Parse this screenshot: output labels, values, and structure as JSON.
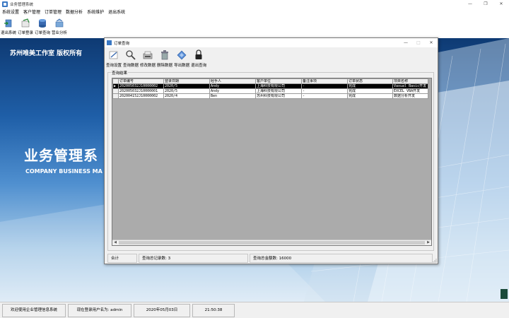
{
  "app": {
    "title": "业务管理系统",
    "controls": [
      "—",
      "❐",
      "✕"
    ]
  },
  "menu": {
    "items": [
      "系统设置",
      "客户管理",
      "订单管理",
      "数据分析",
      "系统维护",
      "退出系统"
    ]
  },
  "toolbar": {
    "items": [
      {
        "label": "退出系统",
        "icon": "exit-icon"
      },
      {
        "label": "订单登录",
        "icon": "order-entry-icon"
      },
      {
        "label": "订单查询",
        "icon": "database-icon"
      },
      {
        "label": "营业分析",
        "icon": "analysis-icon"
      }
    ]
  },
  "desktop": {
    "copyright": "苏州唯美工作室 版权所有",
    "brand_cn": "业务管理系",
    "brand_en": "COMPANY BUSINESS MA"
  },
  "status": {
    "welcome": "欢迎使用企业管理信息系统",
    "user": "现在登录用户名为: admin",
    "date": "2020年05月03日",
    "time": "21:50:38"
  },
  "dialog": {
    "title": "订单查询",
    "controls": [
      "—",
      "□",
      "✕"
    ],
    "toolbar": [
      {
        "label": "查询设置",
        "icon": "settings-icon"
      },
      {
        "label": "查询数据",
        "icon": "search-icon"
      },
      {
        "label": "修改数据",
        "icon": "edit-icon"
      },
      {
        "label": "删除数据",
        "icon": "delete-icon"
      },
      {
        "label": "导出数据",
        "icon": "export-icon"
      },
      {
        "label": "退出查询",
        "icon": "lock-icon"
      }
    ],
    "group_label": "查询结果",
    "columns": [
      "订单编号",
      "登录日期",
      "经手人",
      "客户单位",
      "备注事项",
      "订单状态",
      "项目名称"
    ],
    "rows": [
      [
        "202005032J10000002",
        "2020/5",
        "Andy",
        "上海科技有限公司",
        "-",
        "完成",
        "Vaxual Basic开发"
      ],
      [
        "202005032J10000001",
        "2020/5",
        "Andy",
        "上海科技有限公司",
        "-",
        "完成",
        "EXCEL VBA开发"
      ],
      [
        "202004152J10000002",
        "2020/4",
        "Ben",
        "苏州科技有限公司",
        "-",
        "完成",
        "数据分析开发"
      ]
    ],
    "selected_row": 0,
    "summary": {
      "label": "合计",
      "count_text": "查询总记录数: 3",
      "amount_text": "查询总金额数: 16000"
    }
  },
  "colors": {
    "desktop_top": "#0e3a73",
    "desktop_bottom": "#d9e8f5",
    "selection": "#000000",
    "chrome": "#f0f0f0"
  }
}
